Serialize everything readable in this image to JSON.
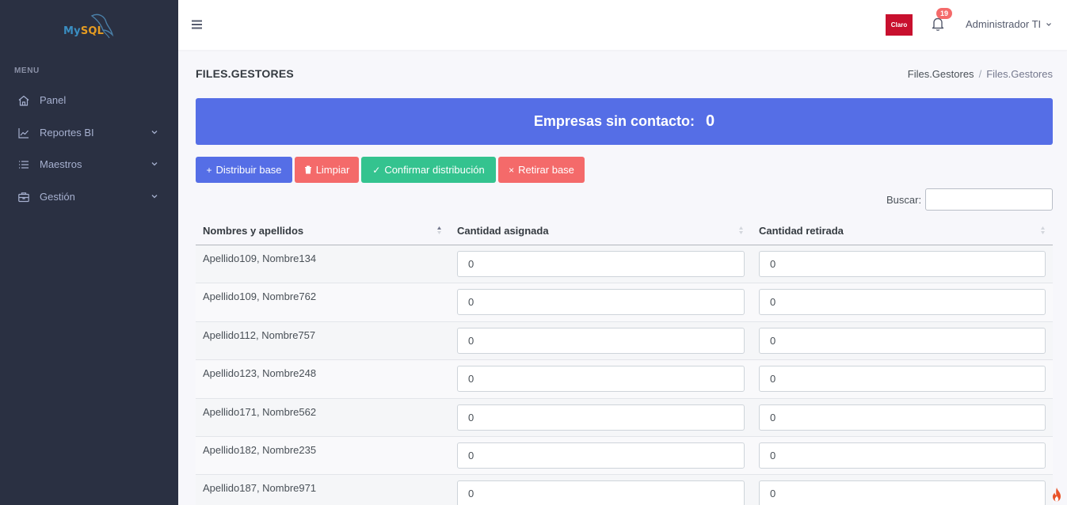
{
  "sidebar": {
    "logo": {
      "part1": "My",
      "part2": "SQL"
    },
    "menu_title": "MENU",
    "items": [
      {
        "label": "Panel",
        "icon": "home-icon"
      },
      {
        "label": "Reportes BI",
        "icon": "chart-line-icon"
      },
      {
        "label": "Maestros",
        "icon": "list-icon"
      },
      {
        "label": "Gestión",
        "icon": "briefcase-icon"
      }
    ]
  },
  "topbar": {
    "brand_logo": "Claro",
    "notifications_count": "19",
    "user_name": "Administrador TI"
  },
  "page": {
    "title": "FILES.GESTORES",
    "breadcrumb": [
      "Files.Gestores",
      "/",
      "Files.Gestores"
    ]
  },
  "banner": {
    "label": "Empresas sin contacto:",
    "value": "0"
  },
  "actions": {
    "distribute": "Distribuir base",
    "clear": "Limpiar",
    "confirm": "Confirmar distribución",
    "withdraw": "Retirar base"
  },
  "search": {
    "label": "Buscar:",
    "value": ""
  },
  "table": {
    "headers": [
      "Nombres y apellidos",
      "Cantidad asignada",
      "Cantidad retirada"
    ],
    "rows": [
      {
        "name": "Apellido109, Nombre134",
        "asignada": "0",
        "retirada": "0"
      },
      {
        "name": "Apellido109, Nombre762",
        "asignada": "0",
        "retirada": "0"
      },
      {
        "name": "Apellido112, Nombre757",
        "asignada": "0",
        "retirada": "0"
      },
      {
        "name": "Apellido123, Nombre248",
        "asignada": "0",
        "retirada": "0"
      },
      {
        "name": "Apellido171, Nombre562",
        "asignada": "0",
        "retirada": "0"
      },
      {
        "name": "Apellido182, Nombre235",
        "asignada": "0",
        "retirada": "0"
      },
      {
        "name": "Apellido187, Nombre971",
        "asignada": "0",
        "retirada": "0"
      }
    ]
  },
  "colors": {
    "sidebar": "#2a3042",
    "primary": "#556ee6",
    "danger": "#f46a6a",
    "success": "#34c38f",
    "claro": "#c8102e"
  }
}
